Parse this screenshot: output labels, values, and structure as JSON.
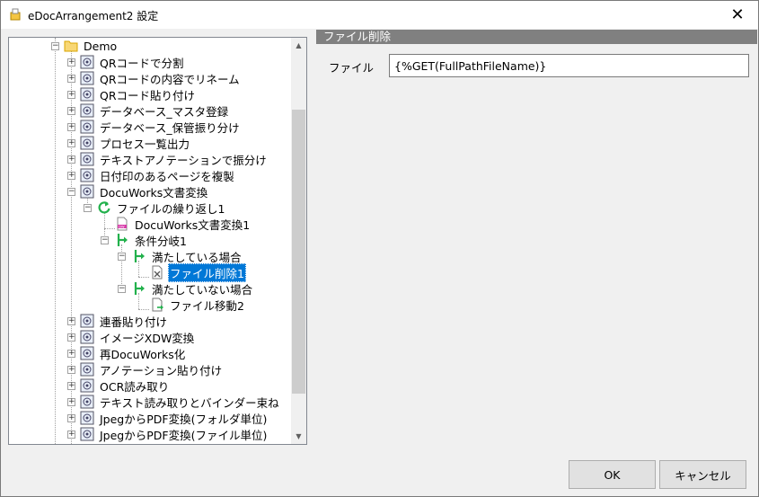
{
  "window": {
    "title": "eDocArrangement2 設定"
  },
  "tree": {
    "root": "Demo",
    "items": [
      "QRコードで分割",
      "QRコードの内容でリネーム",
      "QRコード貼り付け",
      "データベース_マスタ登録",
      "データベース_保管振り分け",
      "プロセス一覧出力",
      "テキストアノテーションで振分け",
      "日付印のあるページを複製",
      "DocuWorks文書変換"
    ],
    "loop": "ファイルの繰り返し1",
    "convert": "DocuWorks文書変換1",
    "branch": "条件分岐1",
    "satisfied": "満たしている場合",
    "delete": "ファイル削除1",
    "not_satisfied": "満たしていない場合",
    "move": "ファイル移動2",
    "items_after": [
      "連番貼り付け",
      "イメージXDW変換",
      "再DocuWorks化",
      "アノテーション貼り付け",
      "OCR読み取り",
      "テキスト読み取りとバインダー束ね",
      "JpegからPDF変換(フォルダ単位)",
      "JpegからPDF変換(ファイル単位)"
    ]
  },
  "panel": {
    "header": "ファイル削除",
    "field_label": "ファイル",
    "field_value": "{%GET(FullPathFileName)}"
  },
  "buttons": {
    "ok": "OK",
    "cancel": "キャンセル"
  },
  "colors": {
    "selection": "#0078d7",
    "header_bg": "#808080",
    "branch_green": "#22b14c"
  }
}
